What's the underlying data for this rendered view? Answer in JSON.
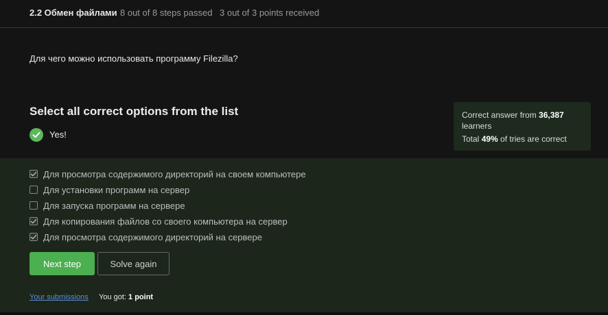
{
  "header": {
    "lesson_title": "2.2 Обмен файлами",
    "steps_status": "8 out of 8 steps passed",
    "points_status": "3 out of 3 points  received"
  },
  "question": {
    "text": "Для чего можно использовать программу Filezilla?"
  },
  "instruction": "Select all correct options from the list",
  "result": {
    "label": "Yes!"
  },
  "stats": {
    "line1_prefix": "Correct answer from ",
    "learners_count": "36,387",
    "line1_suffix": "learners",
    "line2_prefix": "Total ",
    "percent": "49%",
    "line2_suffix": " of tries are correct"
  },
  "options": [
    {
      "text": "Для просмотра содержимого директорий на своем компьютере",
      "checked": true
    },
    {
      "text": "Для установки программ на сервер",
      "checked": false
    },
    {
      "text": "Для запуска программ на сервере",
      "checked": false
    },
    {
      "text": "Для копирования файлов со своего компьютера на сервер",
      "checked": true
    },
    {
      "text": "Для просмотра содержимого директорий на сервере",
      "checked": true
    }
  ],
  "buttons": {
    "next_step": "Next step",
    "solve_again": "Solve again"
  },
  "footer": {
    "submissions_link": "Your submissions",
    "got_prefix": "You got: ",
    "got_value": "1 point"
  },
  "colors": {
    "accent_green": "#4caf50",
    "success_icon": "#5cb85c",
    "link_blue": "#5b8fd6",
    "answers_bg": "#1c261b"
  }
}
